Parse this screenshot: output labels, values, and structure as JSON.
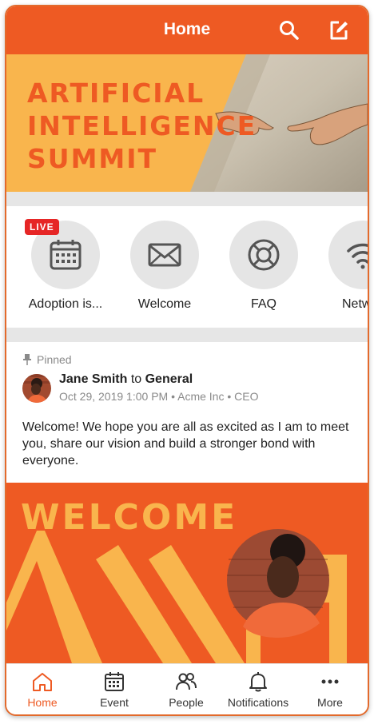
{
  "header": {
    "title": "Home",
    "search_icon": "search-icon",
    "compose_icon": "compose-icon",
    "color": "#ee5a23"
  },
  "banner": {
    "line1": "ARTIFICIAL",
    "line2": "INTELLIGENCE",
    "line3": "SUMMIT"
  },
  "quick_links": [
    {
      "label": "Adoption is...",
      "icon": "calendar-icon",
      "badge": "LIVE"
    },
    {
      "label": "Welcome",
      "icon": "mail-icon"
    },
    {
      "label": "FAQ",
      "icon": "lifebuoy-icon"
    },
    {
      "label": "Netw",
      "icon": "wifi-icon"
    }
  ],
  "post": {
    "pinned_label": "Pinned",
    "author": "Jane Smith",
    "connector": "to",
    "channel": "General",
    "meta": "Oct 29, 2019 1:00 PM • Acme Inc • CEO",
    "text": "Welcome! We hope you are all as excited as I am to meet you, share our vision and build a stronger bond with everyone."
  },
  "welcome_image": {
    "text": "WELCOME"
  },
  "nav": [
    {
      "label": "Home",
      "icon": "home-icon",
      "active": true
    },
    {
      "label": "Event",
      "icon": "calendar-icon"
    },
    {
      "label": "People",
      "icon": "people-icon"
    },
    {
      "label": "Notifications",
      "icon": "bell-icon"
    },
    {
      "label": "More",
      "icon": "more-icon"
    }
  ],
  "colors": {
    "accent": "#ee5a23",
    "yellow": "#f9b54d",
    "live": "#e62626"
  }
}
